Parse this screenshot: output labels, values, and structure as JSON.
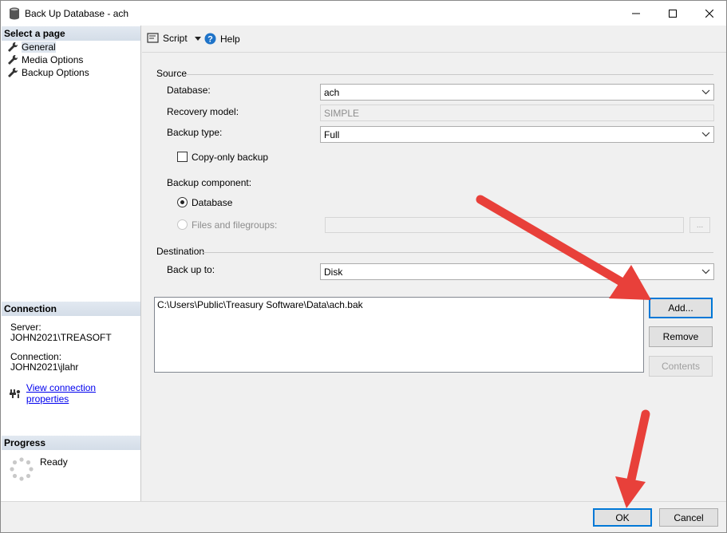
{
  "window": {
    "title": "Back Up Database - ach"
  },
  "left_panel": {
    "select_page_header": "Select a page",
    "pages": [
      {
        "label": "General",
        "selected": true
      },
      {
        "label": "Media Options",
        "selected": false
      },
      {
        "label": "Backup Options",
        "selected": false
      }
    ],
    "connection_header": "Connection",
    "server_label": "Server:",
    "server_value": "JOHN2021\\TREASOFT",
    "connection_label": "Connection:",
    "connection_value": "JOHN2021\\jlahr",
    "view_props_link": "View connection properties",
    "progress_header": "Progress",
    "progress_status": "Ready"
  },
  "toolbar": {
    "script_label": "Script",
    "help_label": "Help"
  },
  "source": {
    "group_label": "Source",
    "database_label": "Database:",
    "database_value": "ach",
    "recovery_label": "Recovery model:",
    "recovery_value": "SIMPLE",
    "backup_type_label": "Backup type:",
    "backup_type_value": "Full",
    "copy_only_label": "Copy-only backup",
    "component_label": "Backup component:",
    "component_database": "Database",
    "component_files": "Files and filegroups:",
    "ellipsis": "..."
  },
  "destination": {
    "group_label": "Destination",
    "back_up_to_label": "Back up to:",
    "back_up_to_value": "Disk",
    "paths": [
      "C:\\Users\\Public\\Treasury Software\\Data\\ach.bak"
    ],
    "add_label": "Add...",
    "remove_label": "Remove",
    "contents_label": "Contents"
  },
  "footer": {
    "ok_label": "OK",
    "cancel_label": "Cancel"
  },
  "colors": {
    "accent": "#0078d7",
    "arrow": "#e8403a",
    "header_bg": "#d4dde8"
  }
}
